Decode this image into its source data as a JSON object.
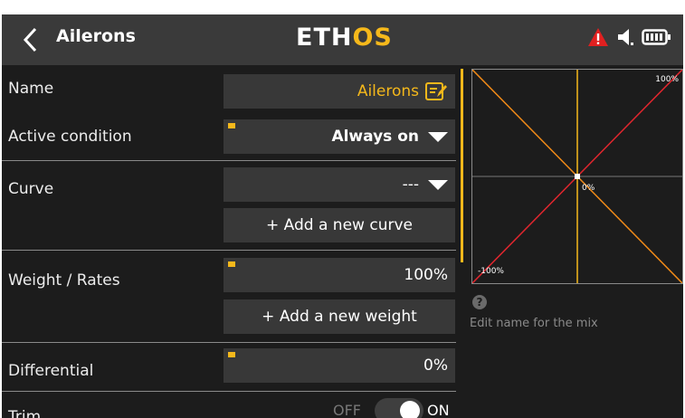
{
  "header": {
    "title": "Ailerons",
    "logo_prefix": "ETH",
    "logo_accent": "OS",
    "icons": [
      "back-chevron-icon",
      "warning-icon",
      "speaker-icon",
      "battery-icon"
    ]
  },
  "fields": {
    "name_label": "Name",
    "name_value": "Ailerons",
    "active_condition_label": "Active condition",
    "active_condition_value": "Always on",
    "curve_label": "Curve",
    "curve_value": "---",
    "add_curve_label": "+ Add a new curve",
    "weight_label": "Weight / Rates",
    "weight_value": "100%",
    "add_weight_label": "+ Add a new weight",
    "differential_label": "Differential",
    "differential_value": "0%",
    "trim_label": "Trim",
    "trim_off": "OFF",
    "trim_on": "ON",
    "trim_state": "on"
  },
  "graph": {
    "top_right_label": "100%",
    "center_label": "0%",
    "bottom_left_label": "-100%"
  },
  "help": {
    "icon": "?",
    "text": "Edit name for the mix"
  },
  "colors": {
    "accent": "#f5b81b",
    "background": "#1c1c1c",
    "header": "#3a3a3a",
    "field": "#383838",
    "curve_red": "#e0262e",
    "curve_orange": "#f08a18",
    "warning": "#e02020"
  }
}
